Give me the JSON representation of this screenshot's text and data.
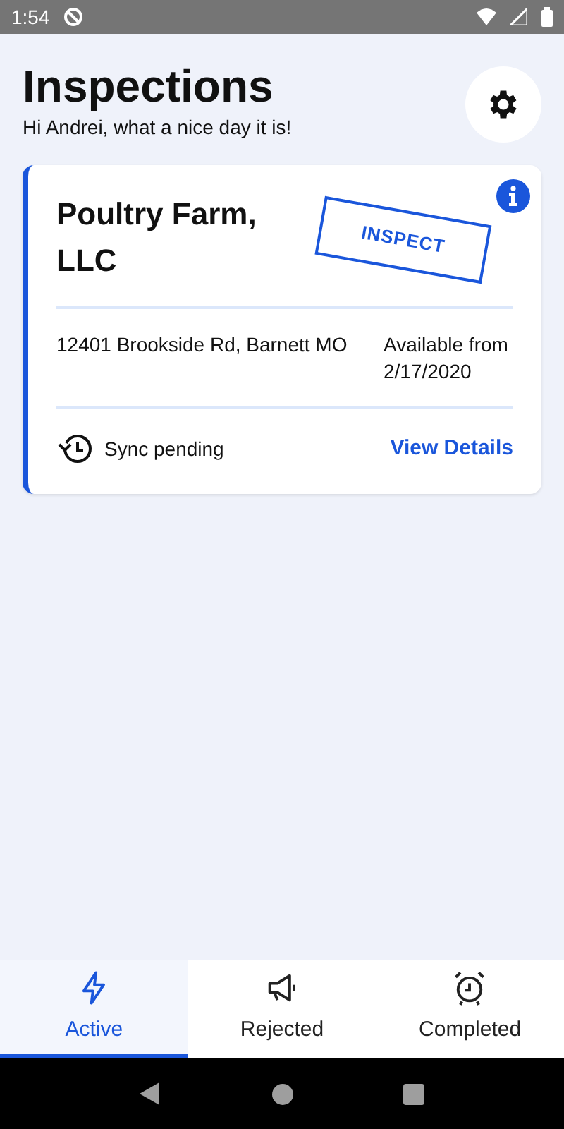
{
  "status_bar": {
    "time": "1:54"
  },
  "header": {
    "title": "Inspections",
    "greeting": "Hi Andrei, what a nice day it is!"
  },
  "inspections": [
    {
      "name": "Poultry Farm, LLC",
      "stamp": "INSPECT",
      "address": "12401 Brookside Rd, Barnett MO",
      "availability": "Available from 2/17/2020",
      "sync_status": "Sync pending",
      "action": "View Details"
    }
  ],
  "tabs": [
    {
      "kind": "bolt",
      "label": "Active",
      "selected": true
    },
    {
      "kind": "megaphone",
      "label": "Rejected",
      "selected": false
    },
    {
      "kind": "alarm",
      "label": "Completed",
      "selected": false
    }
  ]
}
